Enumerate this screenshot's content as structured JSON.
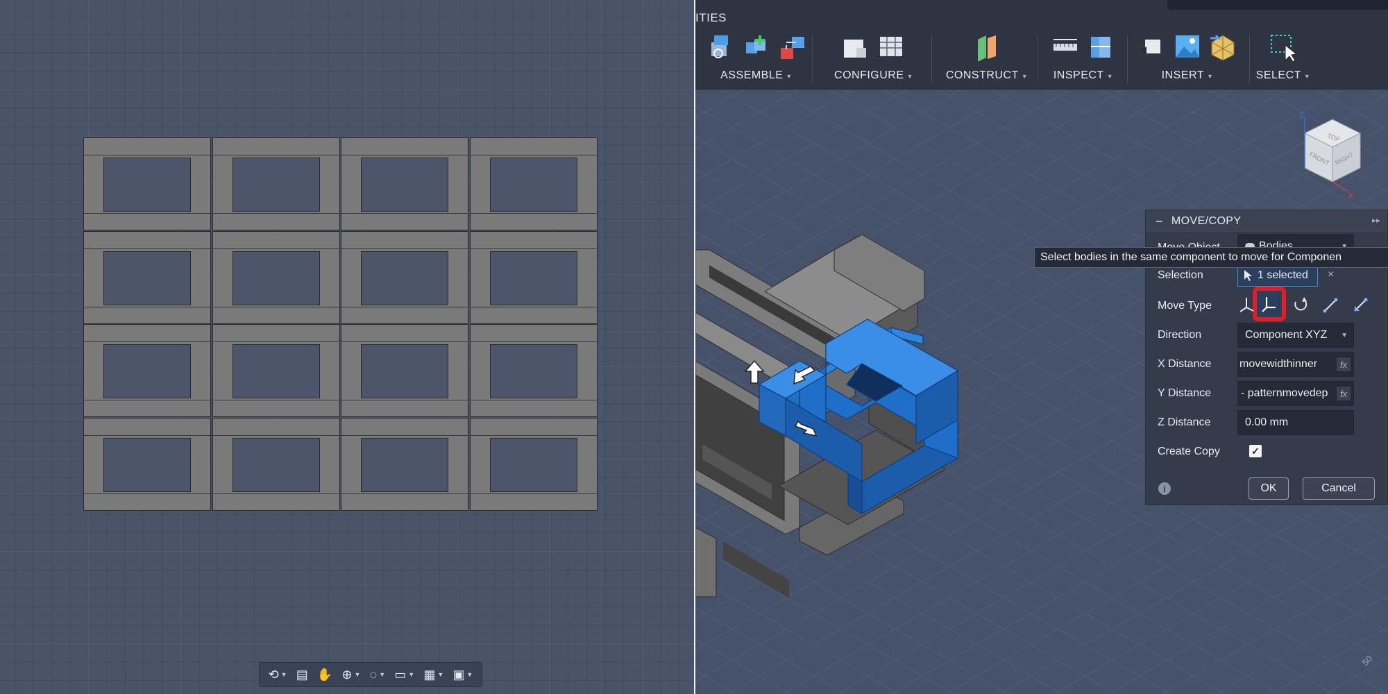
{
  "left_panel": {
    "grid": {
      "rows": 4,
      "cols": 4
    },
    "nav_toolbar": {
      "buttons": [
        {
          "name": "orbit-icon",
          "glyph": "⟲",
          "has_menu": true
        },
        {
          "name": "look-at-icon",
          "glyph": "▤",
          "has_menu": false
        },
        {
          "name": "pan-icon",
          "glyph": "✋",
          "has_menu": false
        },
        {
          "name": "zoom-icon",
          "glyph": "⊕",
          "has_menu": true
        },
        {
          "name": "fit-icon",
          "glyph": "◌",
          "has_menu": true
        },
        {
          "name": "display-settings-icon",
          "glyph": "▭",
          "has_menu": true
        },
        {
          "name": "grid-settings-icon",
          "glyph": "▦",
          "has_menu": true
        },
        {
          "name": "viewports-icon",
          "glyph": "▣",
          "has_menu": true
        }
      ]
    }
  },
  "toolbar": {
    "title_fragment": "ITIES",
    "groups": [
      {
        "label": "ASSEMBLE",
        "icons": [
          "new-component-icon",
          "joint-icon",
          "rigid-group-icon"
        ]
      },
      {
        "label": "CONFIGURE",
        "icons": [
          "configure-icon",
          "table-icon"
        ]
      },
      {
        "label": "CONSTRUCT",
        "icons": [
          "offset-plane-icon"
        ]
      },
      {
        "label": "INSPECT",
        "icons": [
          "measure-icon",
          "section-analysis-icon"
        ]
      },
      {
        "label": "INSERT",
        "icons": [
          "insert-derive-icon",
          "insert-image-icon",
          "insert-mesh-icon"
        ]
      },
      {
        "label": "SELECT",
        "icons": [
          "select-icon"
        ]
      }
    ]
  },
  "viewcube": {
    "top": "TOP",
    "front": "FRONT",
    "right": "RIGHT",
    "axis_z": "Z",
    "axis_x": "X"
  },
  "tooltip": {
    "text": "Select bodies in the same component to move for Componen"
  },
  "dialog": {
    "title": "MOVE/COPY",
    "move_object": {
      "label": "Move Object",
      "value": "Bodies"
    },
    "selection": {
      "label": "Selection",
      "value": "1 selected"
    },
    "move_type": {
      "label": "Move Type"
    },
    "direction": {
      "label": "Direction",
      "value": "Component XYZ"
    },
    "x_distance": {
      "label": "X Distance",
      "value": "movewidthinner"
    },
    "y_distance": {
      "label": "Y Distance",
      "value": "- patternmovedep"
    },
    "z_distance": {
      "label": "Z Distance",
      "value": "0.00 mm"
    },
    "create_copy": {
      "label": "Create Copy",
      "checked": true
    },
    "ok_label": "OK",
    "cancel_label": "Cancel"
  },
  "scale_label": "50",
  "colors": {
    "selected_body": "#1f6fc9",
    "highlight": "#e41d23",
    "body_gray": "#7a7a7a"
  }
}
